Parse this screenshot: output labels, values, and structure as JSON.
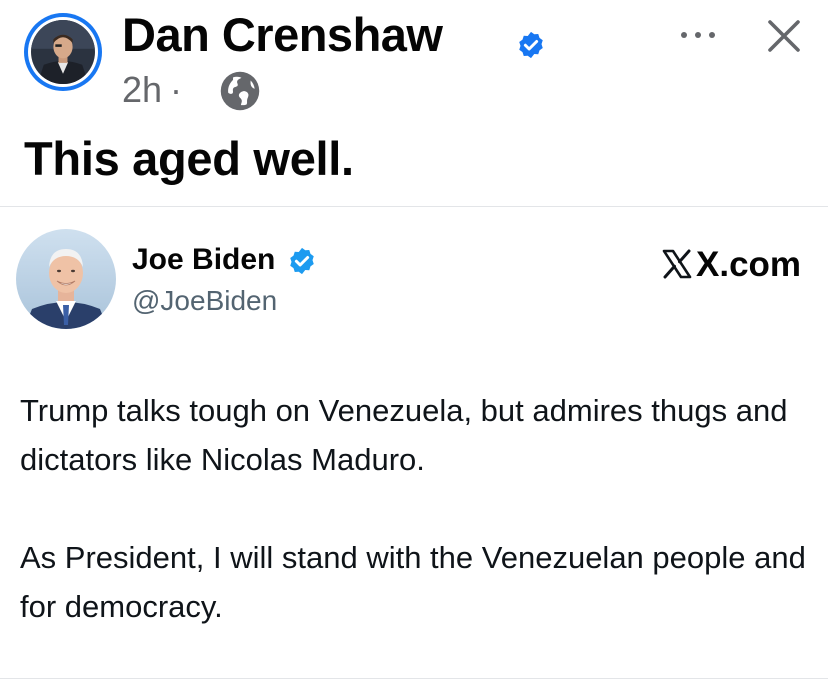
{
  "post": {
    "author_name": "Dan Crenshaw",
    "time": "2h",
    "separator": "·",
    "text": "This aged well.",
    "icons": {
      "verified": "verified-badge-icon",
      "privacy": "globe-icon",
      "more": "more-options-icon",
      "close": "close-icon"
    }
  },
  "tweet": {
    "author_name": "Joe Biden",
    "handle": "@JoeBiden",
    "source": "X.com",
    "paragraphs": [
      "Trump talks tough on Venezuela, but admires thugs and dictators like Nicolas Maduro.",
      "As President, I will stand with the Venezuelan people and for democracy."
    ]
  },
  "colors": {
    "facebook_blue": "#1877f2",
    "meta_gray": "#65676b",
    "x_handle_gray": "#536471",
    "x_verified_blue": "#1d9bf0"
  }
}
